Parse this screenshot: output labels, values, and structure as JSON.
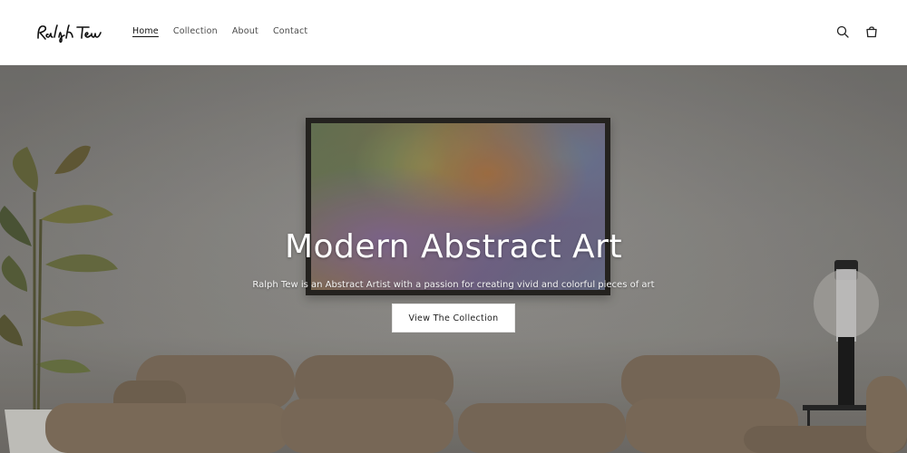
{
  "brand": {
    "logo_text": "Ralph Tew"
  },
  "nav": {
    "items": [
      {
        "label": "Home",
        "active": true
      },
      {
        "label": "Collection",
        "active": false
      },
      {
        "label": "About",
        "active": false
      },
      {
        "label": "Contact",
        "active": false
      }
    ]
  },
  "header_icons": {
    "search": "search-icon",
    "cart": "cart-icon"
  },
  "hero": {
    "title": "Modern Abstract Art",
    "subtitle": "Ralph Tew is an Abstract Artist with a passion for creating vivid and colorful pieces of art",
    "button_label": "View The Collection"
  },
  "colors": {
    "header_bg": "#ffffff",
    "text": "#222222",
    "hero_text": "#ffffff",
    "button_bg": "#ffffff"
  }
}
